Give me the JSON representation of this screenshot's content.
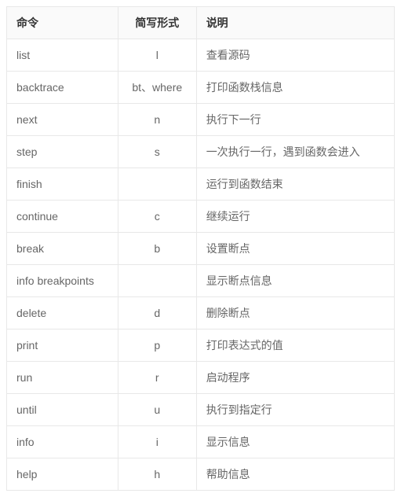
{
  "table": {
    "headers": {
      "command": "命令",
      "shortform": "简写形式",
      "description": "说明"
    },
    "rows": [
      {
        "command": "list",
        "shortform": "l",
        "description": "查看源码"
      },
      {
        "command": "backtrace",
        "shortform": "bt、where",
        "description": "打印函数栈信息"
      },
      {
        "command": "next",
        "shortform": "n",
        "description": "执行下一行"
      },
      {
        "command": "step",
        "shortform": "s",
        "description": "一次执行一行，遇到函数会进入"
      },
      {
        "command": "finish",
        "shortform": "",
        "description": "运行到函数结束"
      },
      {
        "command": "continue",
        "shortform": "c",
        "description": "继续运行"
      },
      {
        "command": "break",
        "shortform": "b",
        "description": "设置断点"
      },
      {
        "command": "info breakpoints",
        "shortform": "",
        "description": "显示断点信息"
      },
      {
        "command": "delete",
        "shortform": "d",
        "description": "删除断点"
      },
      {
        "command": "print",
        "shortform": "p",
        "description": "打印表达式的值"
      },
      {
        "command": "run",
        "shortform": "r",
        "description": "启动程序"
      },
      {
        "command": "until",
        "shortform": "u",
        "description": "执行到指定行"
      },
      {
        "command": "info",
        "shortform": "i",
        "description": "显示信息"
      },
      {
        "command": "help",
        "shortform": "h",
        "description": "帮助信息"
      }
    ]
  }
}
